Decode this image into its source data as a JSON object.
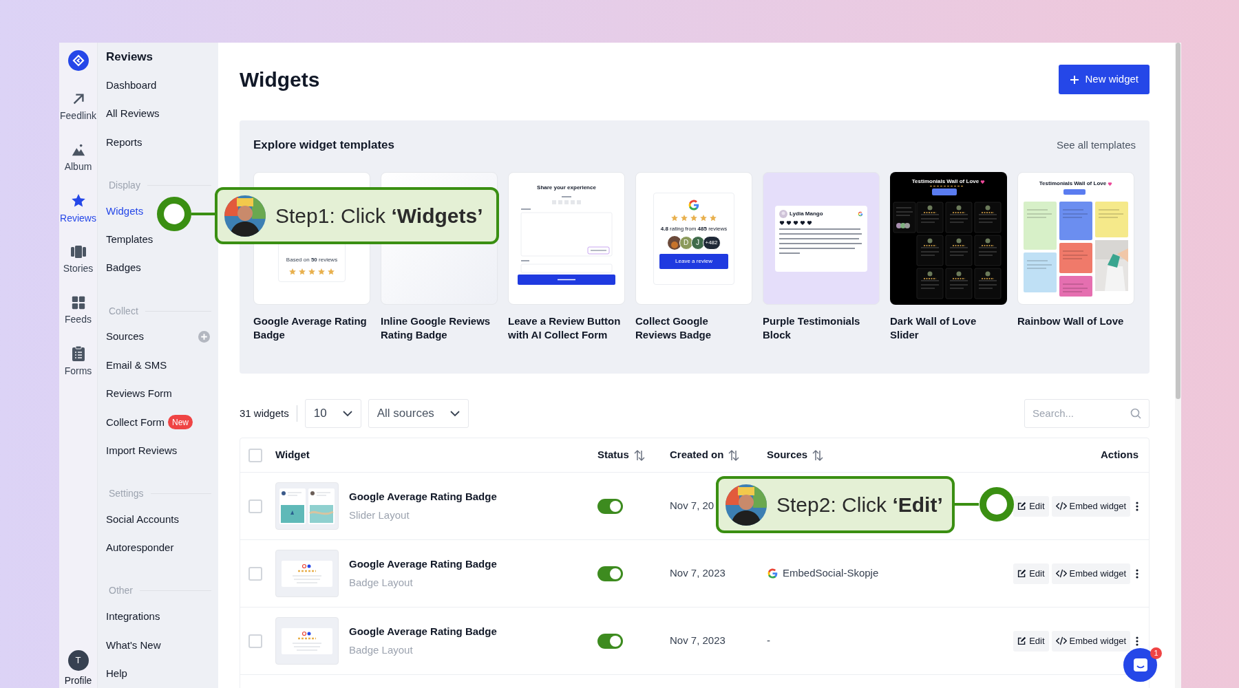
{
  "rail": {
    "items": [
      {
        "label": "Feedlink",
        "selected": false
      },
      {
        "label": "Album",
        "selected": false
      },
      {
        "label": "Reviews",
        "selected": true
      },
      {
        "label": "Stories",
        "selected": false
      },
      {
        "label": "Feeds",
        "selected": false
      },
      {
        "label": "Forms",
        "selected": false
      }
    ],
    "profile": {
      "initial": "T",
      "label": "Profile"
    }
  },
  "nav": {
    "title": "Reviews",
    "sections": [
      {
        "items": [
          {
            "label": "Dashboard",
            "selected": false
          },
          {
            "label": "All Reviews",
            "selected": false
          },
          {
            "label": "Reports",
            "selected": false
          }
        ]
      },
      {
        "heading": "Display",
        "items": [
          {
            "label": "Widgets",
            "selected": true
          },
          {
            "label": "Templates",
            "selected": false
          },
          {
            "label": "Badges",
            "selected": false
          }
        ]
      },
      {
        "heading": "Collect",
        "items": [
          {
            "label": "Sources",
            "selected": false,
            "add_button": true
          },
          {
            "label": "Email & SMS",
            "selected": false
          },
          {
            "label": "Reviews Form",
            "selected": false
          },
          {
            "label": "Collect Form",
            "selected": false,
            "badge": "New"
          },
          {
            "label": "Import Reviews",
            "selected": false
          }
        ]
      },
      {
        "heading": "Settings",
        "items": [
          {
            "label": "Social Accounts",
            "selected": false
          },
          {
            "label": "Autoresponder",
            "selected": false
          }
        ]
      },
      {
        "heading": "Other",
        "items": [
          {
            "label": "Integrations",
            "selected": false
          },
          {
            "label": "What's New",
            "selected": false
          },
          {
            "label": "Help",
            "selected": false
          }
        ]
      }
    ]
  },
  "page": {
    "title": "Widgets",
    "new_button": "New widget"
  },
  "templates": {
    "title": "Explore widget templates",
    "link": "See all templates",
    "cards": [
      {
        "title": "Google Average Rating Badge",
        "preview": {
          "kind": "rating-badge",
          "text": "Based on **50** reviews",
          "stars": 5
        }
      },
      {
        "title": "Inline Google Reviews Rating Badge",
        "preview": {
          "kind": "inline-badge"
        }
      },
      {
        "title": "Leave a Review Button with AI Collect Form",
        "preview": {
          "kind": "review-form",
          "heading": "Share your experience"
        }
      },
      {
        "title": "Collect Google Reviews Badge",
        "preview": {
          "kind": "collect-badge",
          "stars": 5,
          "text": "**4.8** rating from **485** reviews",
          "avatars": [
            "D",
            "J"
          ],
          "more": "+482",
          "button": "Leave a review"
        }
      },
      {
        "title": "Purple Testimonials Block",
        "preview": {
          "kind": "testimonial",
          "name": "Lydia Mango",
          "stars": 5
        }
      },
      {
        "title": "Dark Wall of Love Slider",
        "preview": {
          "kind": "dark-wall",
          "heading": "Testimonials Wall of Love"
        }
      },
      {
        "title": "Rainbow Wall of Love",
        "preview": {
          "kind": "rainbow-wall",
          "heading": "Testimonials Wall of Love"
        }
      }
    ]
  },
  "toolbar": {
    "count": "31 widgets",
    "page_size": "10",
    "source_filter": "All sources",
    "search": {
      "placeholder": "Search..."
    }
  },
  "table": {
    "header_checked": false,
    "columns": [
      {
        "label": "Widget",
        "sortable": false
      },
      {
        "label": "Status",
        "sortable": true
      },
      {
        "label": "Created on",
        "sortable": true
      },
      {
        "label": "Sources",
        "sortable": true
      },
      {
        "label": "Actions",
        "sortable": false
      }
    ],
    "rows": [
      {
        "checked": false,
        "kind": "slider",
        "name": "Google Average Rating Badge",
        "layout": "Slider Layout",
        "on": true,
        "created": "Nov 7, 20",
        "actions": [
          "Edit",
          "Embed widget"
        ]
      },
      {
        "checked": false,
        "kind": "badge",
        "name": "Google Average Rating Badge",
        "layout": "Badge Layout",
        "on": true,
        "created": "Nov 7, 2023",
        "source": {
          "kind": "google",
          "label": "EmbedSocial-Skopje"
        },
        "actions": [
          "Edit",
          "Embed widget"
        ]
      },
      {
        "checked": false,
        "kind": "badge",
        "name": "Google Average Rating Badge",
        "layout": "Badge Layout",
        "on": true,
        "created": "Nov 7, 2023",
        "source": {
          "kind": "none",
          "label": "-"
        },
        "actions": [
          "Edit",
          "Embed widget"
        ]
      }
    ]
  },
  "callouts": [
    {
      "text": "Step1: Click **‘Widgets’**"
    },
    {
      "text": "Step2: Click **‘Edit’**"
    }
  ],
  "chat": {
    "badge": "1"
  }
}
